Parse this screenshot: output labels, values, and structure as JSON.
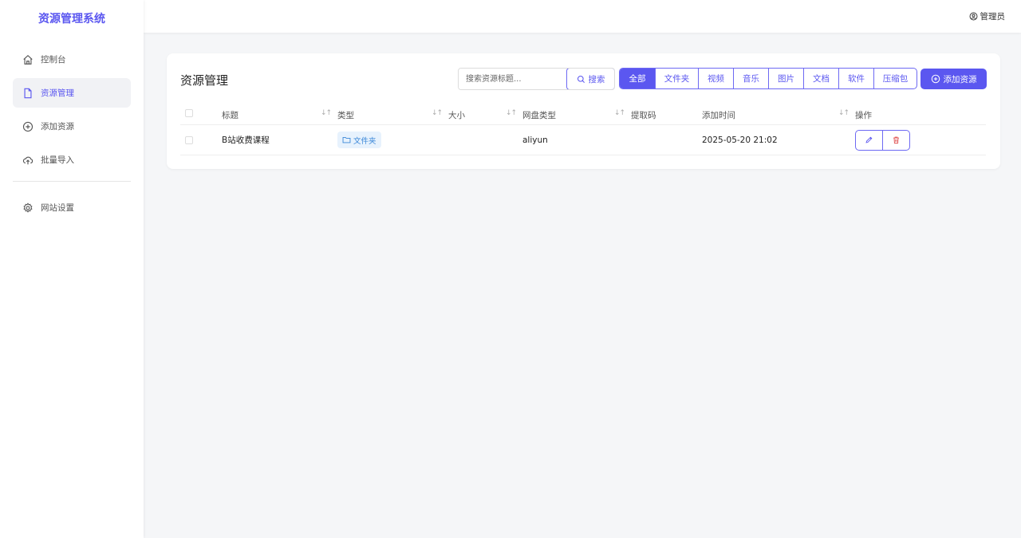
{
  "brand": "资源管理系统",
  "sidebar": {
    "items": [
      {
        "label": "控制台",
        "icon": "home-icon"
      },
      {
        "label": "资源管理",
        "icon": "file-icon",
        "active": true
      },
      {
        "label": "添加资源",
        "icon": "plus-circle-icon"
      },
      {
        "label": "批量导入",
        "icon": "cloud-upload-icon"
      }
    ],
    "settings": {
      "label": "网站设置",
      "icon": "gear-icon"
    }
  },
  "header": {
    "user_label": "管理员",
    "user_icon": "user-circle-icon"
  },
  "main": {
    "title": "资源管理",
    "search": {
      "placeholder": "搜索资源标题...",
      "button_label": "搜索"
    },
    "filters": [
      "全部",
      "文件夹",
      "视频",
      "音乐",
      "图片",
      "文档",
      "软件",
      "压缩包"
    ],
    "active_filter": "全部",
    "add_button": "添加资源",
    "table": {
      "columns": [
        "标题",
        "类型",
        "大小",
        "网盘类型",
        "提取码",
        "添加时间",
        "操作"
      ],
      "rows": [
        {
          "title": "B站收费课程",
          "type": "文件夹",
          "size": "",
          "disk": "aliyun",
          "code": "",
          "time": "2025-05-20 21:02"
        }
      ]
    }
  },
  "colors": {
    "accent": "#5b57f0",
    "tag_bg": "#e7f2fd",
    "tag_text": "#3a87d8",
    "delete": "#e05252"
  }
}
